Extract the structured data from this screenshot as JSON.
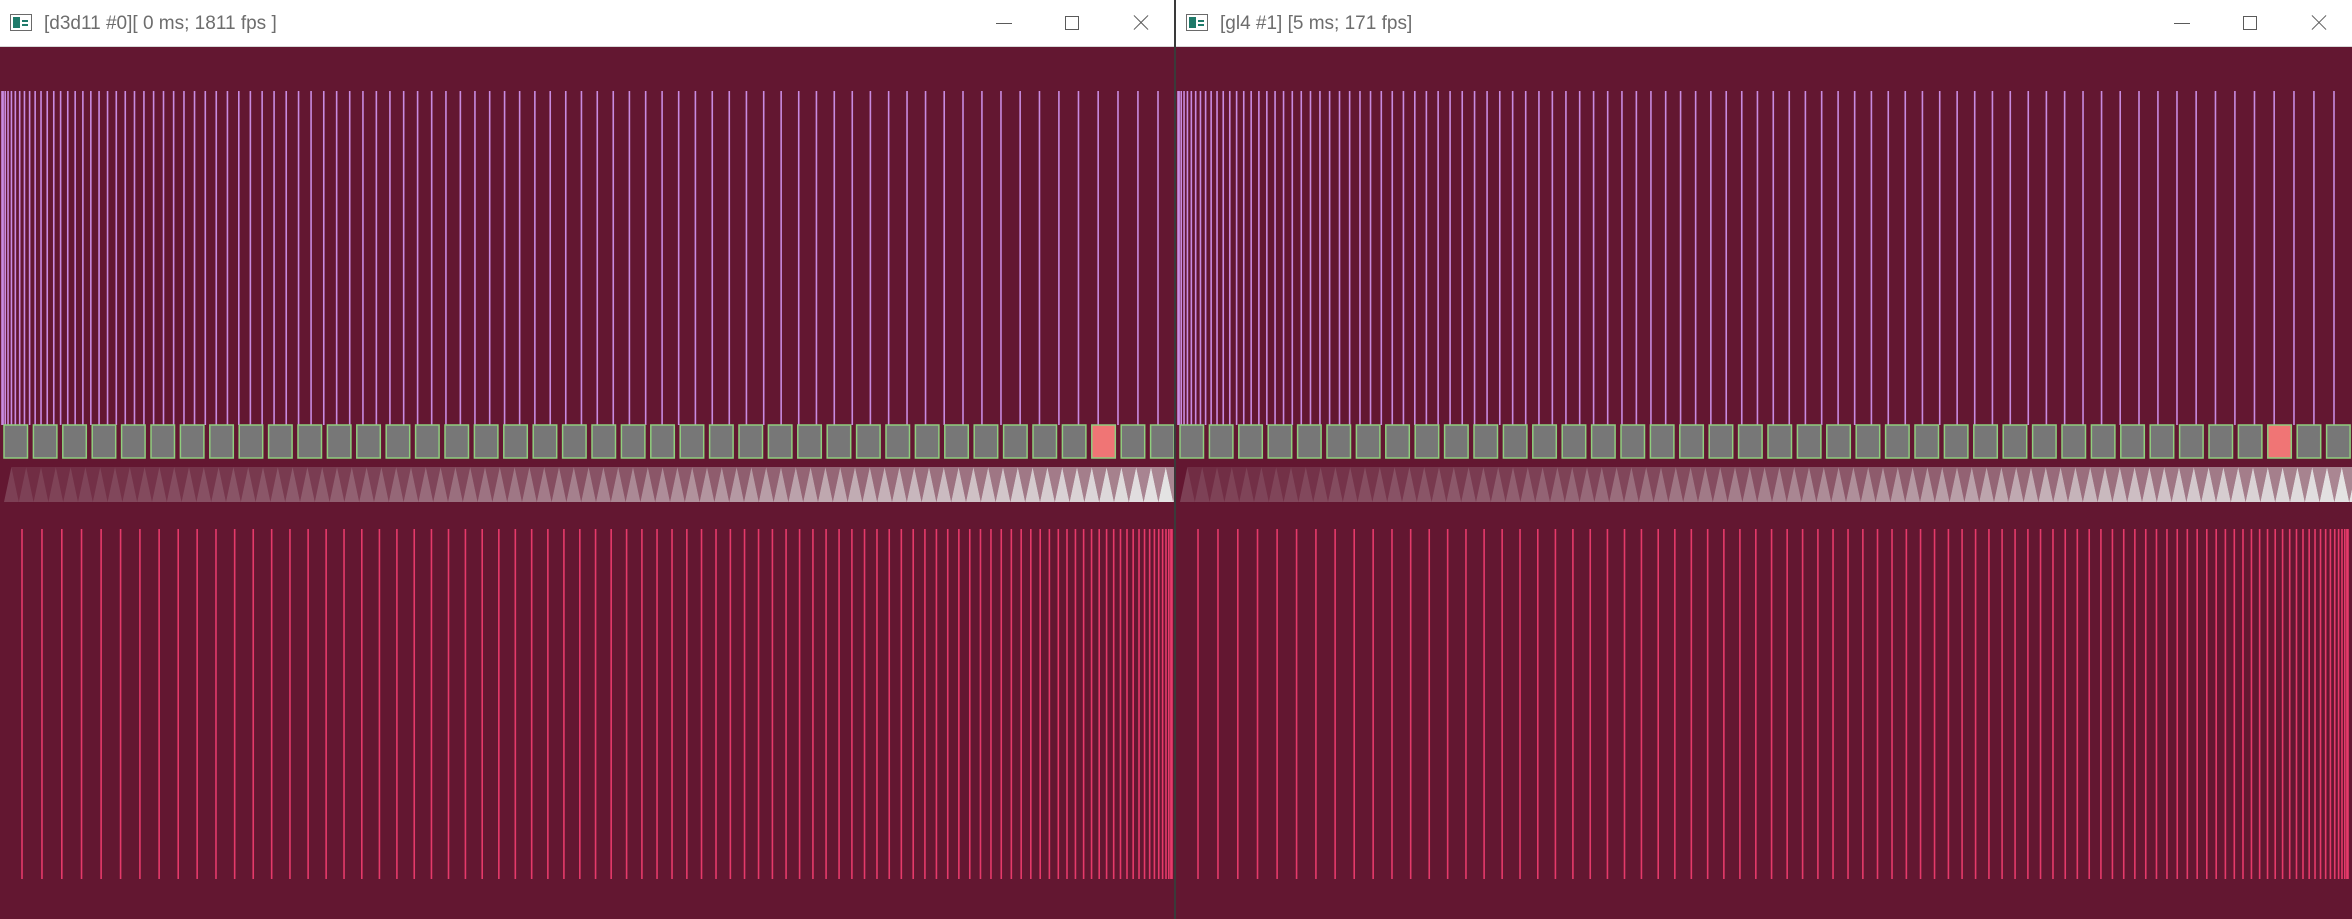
{
  "windows": [
    {
      "id": "left",
      "title": "[d3d11 #0][ 0 ms; 1811 fps ]"
    },
    {
      "id": "right",
      "title": "[gl4 #1] [5 ms; 171 fps]"
    }
  ],
  "colors": {
    "background": "#631731",
    "top_lines": "#c98be0",
    "bottom_lines": "#e53a6a",
    "box_fill": "#777777",
    "box_border": "#8fce7e",
    "box_highlight": "#f07575",
    "triangle_light": "#e6e6e6",
    "triangle_dark": "#631731"
  },
  "icons": [
    "app-icon",
    "minimize-icon",
    "maximize-icon",
    "close-icon"
  ]
}
